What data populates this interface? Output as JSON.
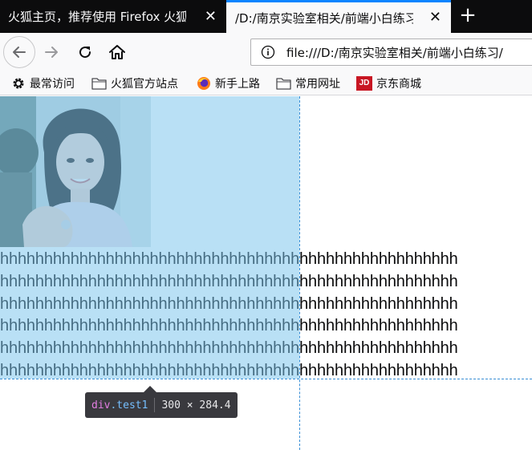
{
  "tabs": [
    {
      "label": "火狐主页，推荐使用 Firefox 火狐浏览器",
      "close": "✕",
      "active": false
    },
    {
      "label": "/D:/南京实验室相关/前端小白练习/",
      "close": "✕",
      "active": true
    }
  ],
  "new_tab_glyph": "+",
  "address_bar": {
    "url": "file:///D:/南京实验室相关/前端小白练习/"
  },
  "bookmarks": [
    {
      "label": "最常访问",
      "icon": "gear-icon"
    },
    {
      "label": "火狐官方站点",
      "icon": "folder-icon"
    },
    {
      "label": "新手上路",
      "icon": "firefox-icon"
    },
    {
      "label": "常用网址",
      "icon": "folder-icon"
    },
    {
      "label": "京东商城",
      "icon": "jd-logo",
      "logo_text": "JD"
    }
  ],
  "content": {
    "lines": [
      "hhhhhhhhhhhhhhhhhhhhhhhhhhhhhhhhhhhhhhhhhhhhhhhhhhhh",
      "hhhhhhhhhhhhhhhhhhhhhhhhhhhhhhhhhhhhhhhhhhhhhhhhhhhh",
      "hhhhhhhhhhhhhhhhhhhhhhhhhhhhhhhhhhhhhhhhhhhhhhhhhhhh",
      "hhhhhhhhhhhhhhhhhhhhhhhhhhhhhhhhhhhhhhhhhhhhhhhhhhhh",
      "hhhhhhhhhhhhhhhhhhhhhhhhhhhhhhhhhhhhhhhhhhhhhhhhhhhh",
      "hhhhhhhhhhhhhhhhhhhhhhhhhhhhhhhhhhhhhhhhhhhhhhhhhhhh"
    ]
  },
  "inspector_tooltip": {
    "tag": "div",
    "class": ".test1",
    "dimensions": "300 × 284.4"
  },
  "colors": {
    "tab_strip": "#0c0c0d",
    "active_tab_accent": "#0a84ff",
    "highlight": "#78c3eb",
    "guide": "#3a8fd6",
    "tooltip_bg": "#39393e"
  }
}
